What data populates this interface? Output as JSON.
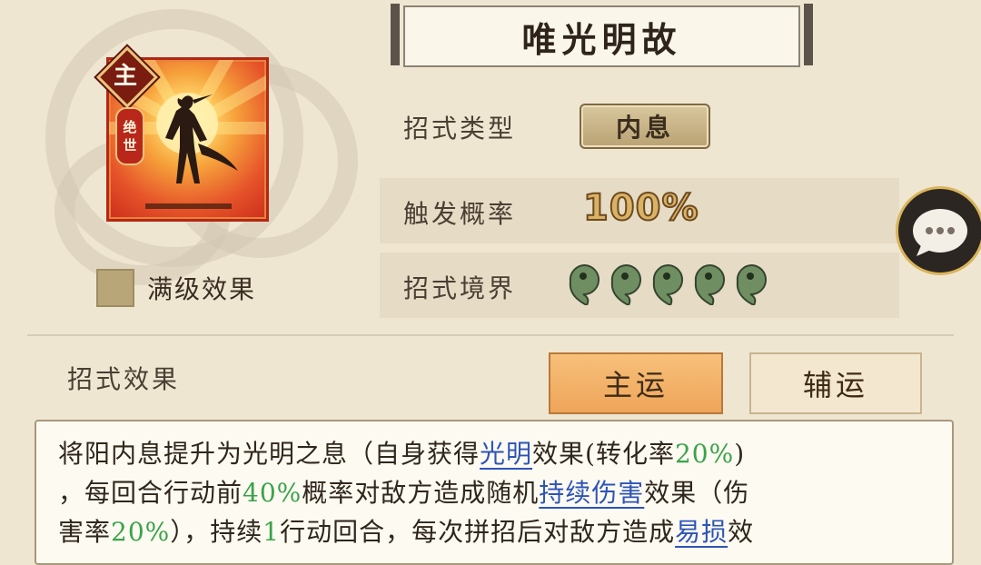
{
  "skill": {
    "name": "唯光明故",
    "badge_main": "主",
    "rank_tag": [
      "绝",
      "世"
    ],
    "full_level_label": "满级效果"
  },
  "stats": {
    "type_label": "招式类型",
    "type_value": "内息",
    "rate_label": "触发概率",
    "rate_value": "100%",
    "level_label": "招式境界",
    "level_orbs": 5
  },
  "effect": {
    "label": "招式效果",
    "tab_main": "主运",
    "tab_aux": "辅运",
    "line1": [
      "将阳内息提升为光明之息（自身获得",
      "光明",
      "效果(转化率",
      "20%",
      ")"
    ],
    "line2": [
      "，每回合行动前",
      "40%",
      "概率对敌方造成随机",
      "持续伤害",
      "效果（伤"
    ],
    "line3": [
      "害率",
      "20%",
      "），持续",
      "1",
      "行动回合，每次拼招后对敌方造成",
      "易损",
      "效"
    ]
  },
  "icons": {
    "chat": "chat-bubble-icon",
    "orb": "jade-orb-icon"
  },
  "colors": {
    "background": "#efe6d2",
    "highlight_green": "#3aa34a",
    "keyword_blue": "#2d54b8",
    "card_red": "#cc2d1b"
  }
}
